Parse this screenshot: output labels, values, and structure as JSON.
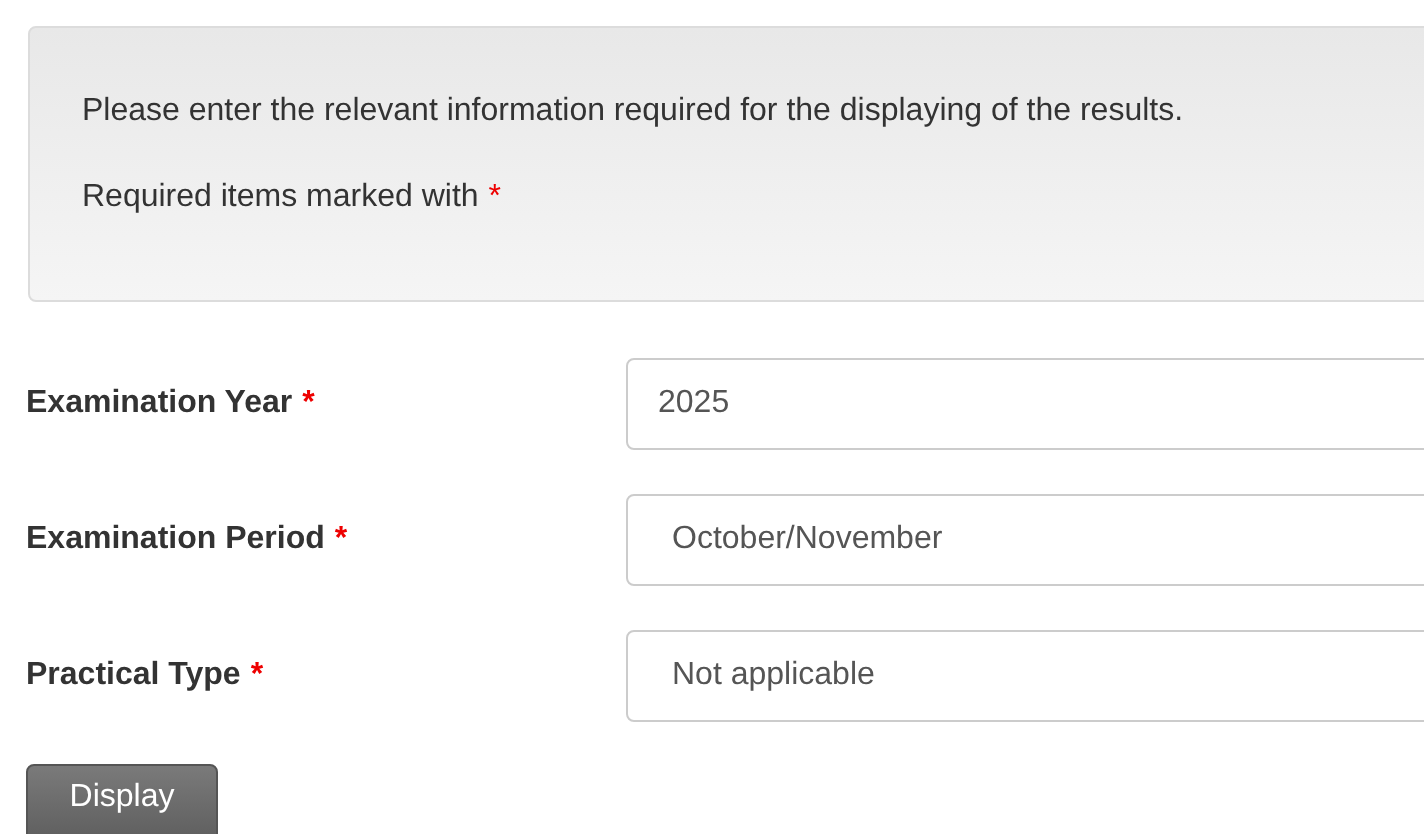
{
  "info_panel": {
    "lines": [
      {
        "text": "Please enter the relevant information required for the displaying of the results."
      },
      {
        "text": "Required items marked with",
        "required_mark": "*"
      }
    ]
  },
  "fields": [
    {
      "label": "Examination Year",
      "required_mark": "*",
      "kind": "input",
      "value": "2025"
    },
    {
      "label": "Examination Period",
      "required_mark": "*",
      "kind": "select",
      "value": "October/November"
    },
    {
      "label": "Practical Type",
      "required_mark": "*",
      "kind": "select",
      "value": "Not applicable"
    }
  ],
  "buttons": [
    {
      "label": "Display"
    }
  ]
}
